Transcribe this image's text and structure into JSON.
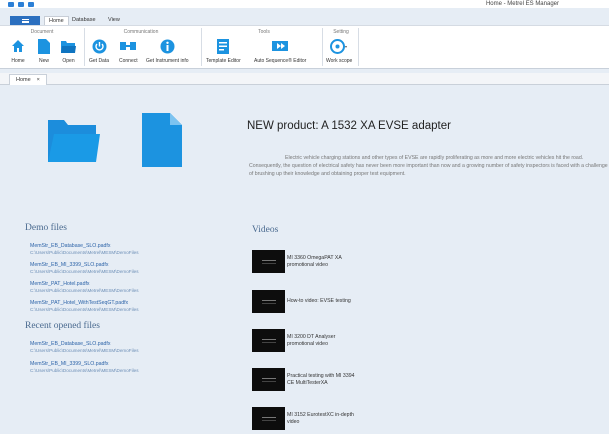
{
  "window": {
    "title": "Home - Metrel ES Manager"
  },
  "tabs": [
    {
      "label": "Home",
      "active": true
    },
    {
      "label": "Database"
    },
    {
      "label": "View"
    }
  ],
  "ribbon": {
    "groups": [
      {
        "title": "Document",
        "buttons": [
          {
            "label": "Home",
            "icon": "home-icon"
          },
          {
            "label": "New",
            "icon": "new-document-icon"
          },
          {
            "label": "Open",
            "icon": "open-folder-icon"
          }
        ]
      },
      {
        "title": "Communication",
        "buttons": [
          {
            "label": "Get Data",
            "icon": "power-icon"
          },
          {
            "label": "Connect",
            "icon": "connect-icon"
          },
          {
            "label": "Get Instrument info",
            "icon": "info-icon"
          }
        ]
      },
      {
        "title": "Tools",
        "buttons": [
          {
            "label": "Template Editor",
            "icon": "template-editor-icon"
          },
          {
            "label": "Auto Sequence® Editor",
            "icon": "sequence-editor-icon"
          }
        ]
      },
      {
        "title": "Setting",
        "buttons": [
          {
            "label": "Work scope",
            "icon": "work-scope-icon"
          }
        ]
      }
    ]
  },
  "document_tabs": [
    {
      "label": "Home",
      "close": "×"
    }
  ],
  "news": {
    "title": "NEW product: A 1532 XA EVSE adapter",
    "body": "Electric vehicle charging stations and other types of EVSE are rapidly proliferating as more and more electric vehicles hit the road. Consequently, the question of electrical safety has never been more important than now and a growing number of safety inspectors is faced with a challenge of brushing up their knowledge and obtaining proper test equipment."
  },
  "demo_files": {
    "title": "Demo files",
    "items": [
      {
        "name": "MemStr_EB_Database_SLO.padfx",
        "path": "C:\\Users\\Public\\Documents\\Metrel\\MESM\\DemoFiles"
      },
      {
        "name": "MemStr_EB_MI_3399_SLO.padfx",
        "path": "C:\\Users\\Public\\Documents\\Metrel\\MESM\\DemoFiles"
      },
      {
        "name": "MemStr_PAT_Hotel.padfx",
        "path": "C:\\Users\\Public\\Documents\\Metrel\\MESM\\DemoFiles"
      },
      {
        "name": "MemStr_PAT_Hotel_WithTestSeqGT.padfx",
        "path": "C:\\Users\\Public\\Documents\\Metrel\\MESM\\DemoFiles"
      }
    ]
  },
  "recent_files": {
    "title": "Recent opened files",
    "items": [
      {
        "name": "MemStr_EB_Database_SLO.padfx",
        "path": "C:\\Users\\Public\\Documents\\Metrel\\MESM\\DemoFiles"
      },
      {
        "name": "MemStr_EB_MI_3399_SLO.padfx",
        "path": "C:\\Users\\Public\\Documents\\Metrel\\MESM\\DemoFiles"
      }
    ]
  },
  "videos": {
    "title": "Videos",
    "items": [
      {
        "label": "MI 3360 OmegaPAT XA promotional video"
      },
      {
        "label": "How-to video: EVSE testing"
      },
      {
        "label": "MI 3200 DT Analyser promotional video"
      },
      {
        "label": "Practical testing with MI 3394 CE MultiTesterXA"
      },
      {
        "label": "MI 3152 EurotestXC in-depth video"
      }
    ]
  },
  "colors": {
    "accent": "#2b7fd6",
    "icon_blue": "#1c93e0",
    "background": "#e6edf5"
  }
}
